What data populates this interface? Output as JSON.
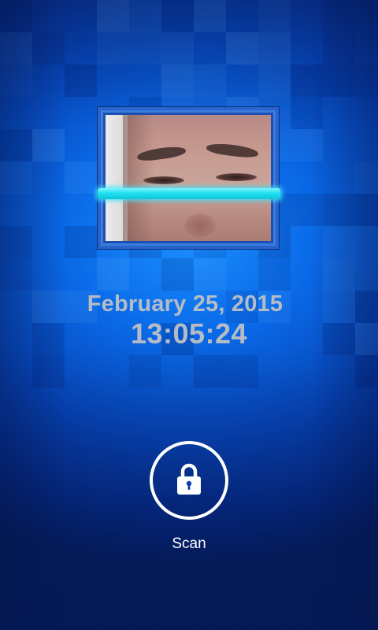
{
  "lockscreen": {
    "date": "February 25, 2015",
    "time": "13:05:24",
    "scan_button_label": "Scan",
    "lock_icon": "padlock-icon"
  },
  "colors": {
    "scan_line": "#1fe0f0",
    "frame_border": "#2a63c9",
    "text_muted": "#b5bcc7",
    "background_center": "#1a8fff",
    "background_edge": "#041c5c"
  }
}
